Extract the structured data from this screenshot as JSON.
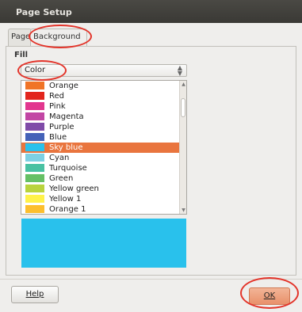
{
  "window": {
    "title": "Page Setup"
  },
  "tabs": [
    {
      "label": "Page"
    },
    {
      "label": "Background"
    }
  ],
  "fill": {
    "section_label": "Fill",
    "type_selected": "Color"
  },
  "colors": {
    "annotation_red": "#e3342a",
    "selection": "#e9753e",
    "preview": "#29c1ec"
  },
  "color_list": [
    {
      "label": "Orange",
      "swatch": "#f07427"
    },
    {
      "label": "Red",
      "swatch": "#e2251d"
    },
    {
      "label": "Pink",
      "swatch": "#e2378f"
    },
    {
      "label": "Magenta",
      "swatch": "#c246a4"
    },
    {
      "label": "Purple",
      "swatch": "#7f4ba8"
    },
    {
      "label": "Blue",
      "swatch": "#4462b8"
    },
    {
      "label": "Sky blue",
      "swatch": "#29c1ec"
    },
    {
      "label": "Cyan",
      "swatch": "#7dd0e3"
    },
    {
      "label": "Turquoise",
      "swatch": "#49c1a2"
    },
    {
      "label": "Green",
      "swatch": "#66c065"
    },
    {
      "label": "Yellow green",
      "swatch": "#b9d33d"
    },
    {
      "label": "Yellow 1",
      "swatch": "#fff24a"
    },
    {
      "label": "Orange 1",
      "swatch": "#fcbf2e"
    }
  ],
  "selected_color": "Sky blue",
  "buttons": {
    "help": "Help",
    "ok": "OK"
  }
}
